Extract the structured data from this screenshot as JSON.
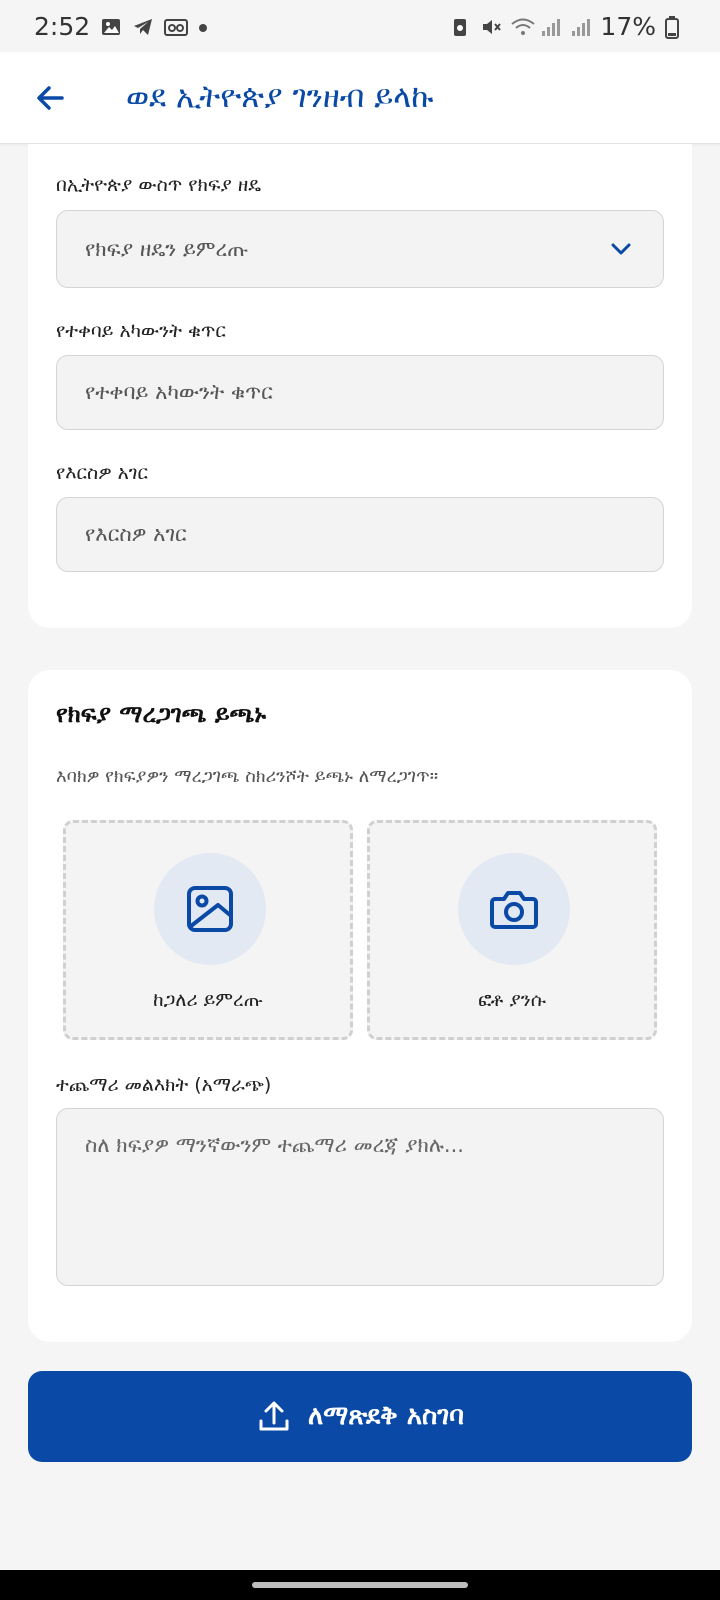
{
  "status_bar": {
    "time": "2:52",
    "battery": "17%",
    "icons": [
      "image-icon",
      "telegram-icon",
      "voicemail-icon",
      "dot-icon",
      "battery-saver-icon",
      "mute-icon",
      "wifi-icon",
      "signal-icon",
      "signal-icon",
      "battery-icon"
    ]
  },
  "app_bar": {
    "title": "ወደ ኢትዮጵያ ገንዘብ ይላኩ",
    "back_icon": "arrow-left-icon"
  },
  "form": {
    "payment_method": {
      "label": "በኢትዮጵያ ውስጥ የክፍያ ዘዴ",
      "placeholder": "የክፍያ ዘዴን ይምረጡ"
    },
    "account_number": {
      "label": "የተቀባይ አካውንት ቁጥር",
      "placeholder": "የተቀባይ አካውንት ቁጥር"
    },
    "country": {
      "label": "የእርስዎ አገር",
      "placeholder": "የእርስዎ አገር"
    }
  },
  "proof": {
    "title": "የክፍያ ማረጋገጫ ይጫኑ",
    "description": "እባክዎ የክፍያዎን ማረጋገጫ ስክሪንሾት ይጫኑ ለማረጋገጥ።",
    "gallery_label": "ከጋለሪ ይምረጡ",
    "camera_label": "ፎቶ ያንሱ"
  },
  "message": {
    "label": "ተጨማሪ መልእክት (አማራጭ)",
    "placeholder": "ስለ ክፍያዎ ማንኛውንም ተጨማሪ መረጃ ያክሉ..."
  },
  "submit": {
    "label": "ለማጽደቅ አስገባ",
    "icon": "upload-icon"
  },
  "colors": {
    "primary": "#0a4aa6",
    "background": "#f5f5f5",
    "card": "#ffffff",
    "field": "#f3f3f3"
  }
}
